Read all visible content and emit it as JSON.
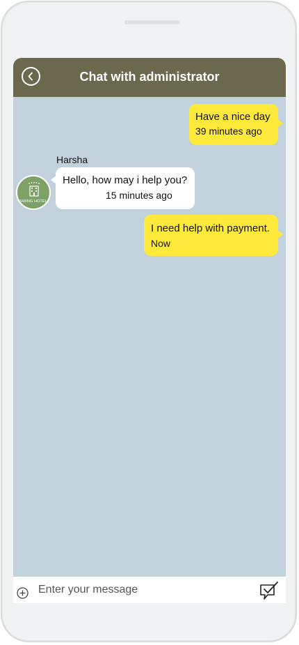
{
  "header": {
    "title": "Chat with administrator",
    "back_icon": "back-arrow-icon"
  },
  "messages": [
    {
      "direction": "outgoing",
      "text": "Have a nice day",
      "time": "39 minutes ago"
    },
    {
      "direction": "incoming",
      "sender": "Harsha",
      "text": "Hello, how may i help you?",
      "time": "15 minutes ago"
    },
    {
      "direction": "outgoing",
      "text": "I need help with payment.",
      "time": "Now"
    }
  ],
  "avatar": {
    "label": "SWING HOTEL",
    "icon": "hotel-building-icon"
  },
  "composer": {
    "placeholder": "Enter your message",
    "attach_icon": "plus-circle-icon",
    "send_icon": "send-check-icon"
  },
  "colors": {
    "header_bg": "#6a694e",
    "chat_bg": "#c2d2dc",
    "outgoing_bubble": "#ffe93a",
    "incoming_bubble": "#ffffff",
    "avatar_bg": "#7ea168"
  }
}
